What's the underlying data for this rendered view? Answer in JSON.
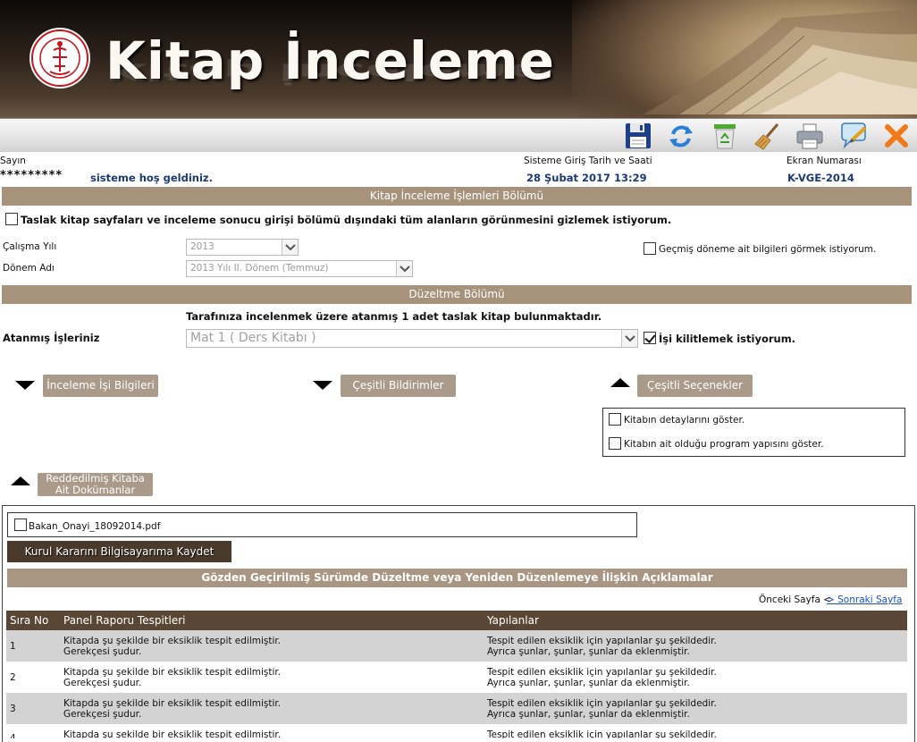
{
  "header": {
    "title": "Kitap İnceleme",
    "logo_icon": "ministry-seal-logo",
    "toolbar": [
      {
        "name": "save-icon",
        "label": "Kaydet"
      },
      {
        "name": "refresh-icon",
        "label": "Yenile"
      },
      {
        "name": "recycle-bin-icon",
        "label": "Sil"
      },
      {
        "name": "broom-icon",
        "label": "Temizle"
      },
      {
        "name": "printer-icon",
        "label": "Yazdır"
      },
      {
        "name": "feedback-icon",
        "label": "Geri Bildirim"
      },
      {
        "name": "close-icon",
        "label": "Kapat"
      }
    ]
  },
  "welcome": {
    "greeting": "Sayın",
    "user_masked": "*********",
    "welcome_text": "sisteme hoş geldiniz.",
    "login_label": "Sisteme Giriş Tarih ve Saati",
    "login_value": "28 Şubat 2017 13:29",
    "screen_label": "Ekran Numarası",
    "screen_value": "K-VGE-2014"
  },
  "operations": {
    "section_title": "Kitap İnceleme İşlemleri Bölümü",
    "hide_fields_label": "Taslak kitap sayfaları ve inceleme sonucu girişi bölümü dışındaki tüm alanların görünmesini gizlemek istiyorum.",
    "year_label": "Çalışma Yılı",
    "year_value": "2013",
    "term_label": "Dönem Adı",
    "term_value": "2013 Yılı II. Dönem (Temmuz)",
    "past_term_label": "Geçmiş döneme ait bilgileri görmek istiyorum."
  },
  "correction": {
    "section_title": "Düzeltme Bölümü",
    "assigned_info": "Tarafınıza incelenmek üzere atanmış 1 adet taslak kitap bulunmaktadır.",
    "assigned_jobs_label": "Atanmış İşleriniz",
    "assigned_job_value": "Mat 1 ( Ders Kitabı )",
    "lock_label": "İşi kilitlemek istiyorum.",
    "lock_checked": true,
    "buttons": {
      "review_info": "İnceleme İşi Bilgileri",
      "notifications": "Çeşitli Bildirimler",
      "options": "Çeşitli Seçenekler",
      "rejected_docs_line1": "Reddedilmiş Kitaba",
      "rejected_docs_line2": "Ait Dokümanlar"
    },
    "options_panel": {
      "show_details": "Kitabın detaylarını göster.",
      "show_program": "Kitabın ait olduğu program yapısını göster."
    }
  },
  "documents": {
    "file_name": "Bakan_Onayi_18092014.pdf",
    "save_button": "Kurul Kararını Bilgisayarıma Kaydet",
    "explanations_title": "Gözden Geçirilmiş Sürümde Düzeltme veya Yeniden Düzenlemeye İlişkin Açıklamalar",
    "pager_prev": "Önceki Sayfa <",
    "pager_next": " > Sonraki Sayfa"
  },
  "table": {
    "columns": [
      "Sıra No",
      "Panel Raporu Tespitleri",
      "Yapılanlar"
    ],
    "rows": [
      {
        "no": "1",
        "finding_1": "Kitapda şu şekilde bir eksiklik tespit edilmiştir.",
        "finding_2": "Gerekçesi şudur.",
        "done_1": "Tespit edilen eksiklik için yapılanlar şu şekildedir.",
        "done_2": "Ayrıca şunlar, şunlar, şunlar da eklenmiştir."
      },
      {
        "no": "2",
        "finding_1": "Kitapda şu şekilde bir eksiklik tespit edilmiştir.",
        "finding_2": "Gerekçesi şudur.",
        "done_1": "Tespit edilen eksiklik için yapılanlar şu şekildedir.",
        "done_2": "Ayrıca şunlar, şunlar, şunlar da eklenmiştir."
      },
      {
        "no": "3",
        "finding_1": "Kitapda şu şekilde bir eksiklik tespit edilmiştir.",
        "finding_2": "Gerekçesi şudur.",
        "done_1": "Tespit edilen eksiklik için yapılanlar şu şekildedir.",
        "done_2": "Ayrıca şunlar, şunlar, şunlar da eklenmiştir."
      },
      {
        "no": "4",
        "finding_1": "Kitapda şu şekilde bir eksiklik tespit edilmiştir.",
        "finding_2": "",
        "done_1": "Tespit edilen eksiklik için yapılanlar şu şekildedir.",
        "done_2": ""
      }
    ]
  },
  "colors": {
    "section_bar": "#a7927c",
    "table_header": "#5a4634",
    "row_alt": "#d3d3d3",
    "accent_blue": "#1b3a73"
  }
}
